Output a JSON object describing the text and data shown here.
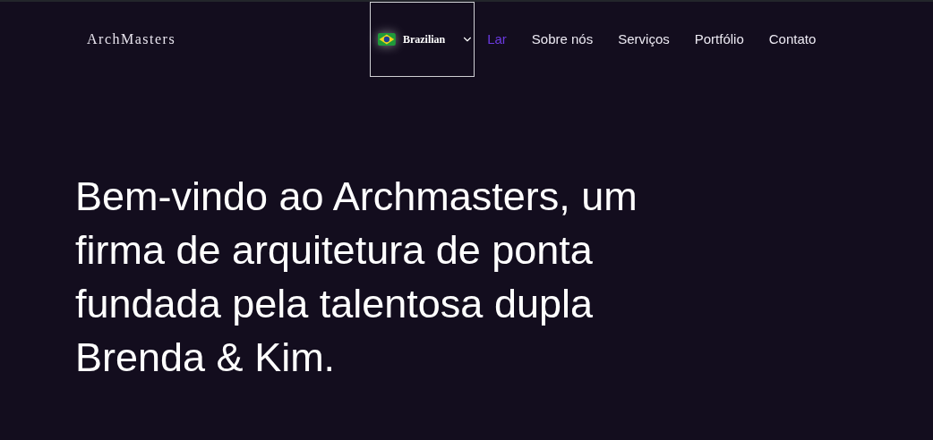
{
  "brand": "ArchMasters",
  "language": {
    "label": "Brazilian"
  },
  "nav": [
    {
      "label": "Lar",
      "selected": true
    },
    {
      "label": "Sobre nós",
      "selected": false
    },
    {
      "label": "Serviços",
      "selected": false
    },
    {
      "label": "Portfólio",
      "selected": false
    },
    {
      "label": "Contato",
      "selected": false
    }
  ],
  "hero": {
    "heading": "Bem-vindo ao Archmasters, um firma de arquitetura de ponta fundada pela talentosa dupla Brenda & Kim."
  }
}
